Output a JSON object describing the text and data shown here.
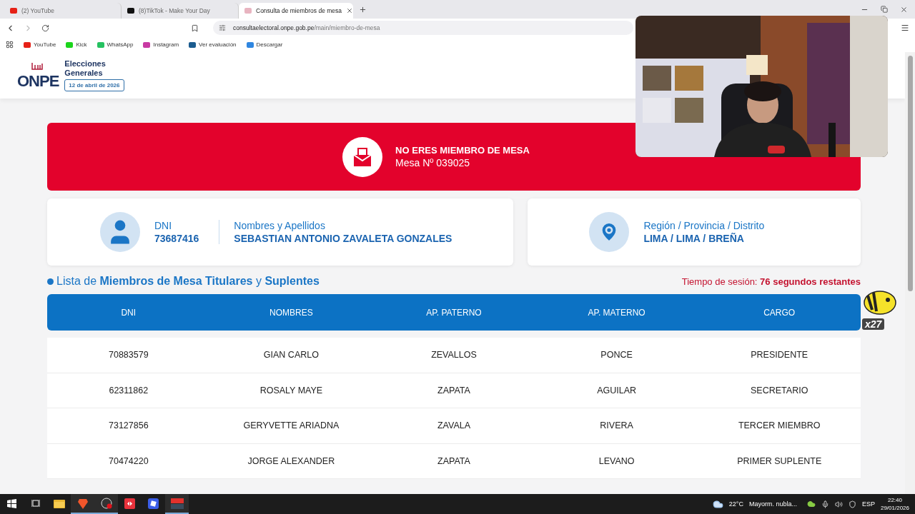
{
  "browser": {
    "tabs": [
      {
        "title": "(2) YouTube",
        "kind": "video",
        "selected": false
      },
      {
        "title": "(8)TikTok - Make Your Day",
        "kind": "note",
        "selected": false
      },
      {
        "title": "Consulta de miembros de mesa",
        "kind": "onpe",
        "selected": true
      }
    ],
    "address": {
      "host": "consultaelectoral.onpe.gob.pe",
      "path": "/main/miembro-de-mesa"
    },
    "bookmarks": [
      {
        "label": "YouTube",
        "color": "#e62117"
      },
      {
        "label": "Kick",
        "color": "#1bd51b"
      },
      {
        "label": "WhatsApp",
        "color": "#25c160"
      },
      {
        "label": "Instagram",
        "color": "#c83aa3"
      },
      {
        "label": "Ver evaluación",
        "color": "#1b5c8f"
      },
      {
        "label": "Descargar",
        "color": "#2f86e0"
      }
    ]
  },
  "header": {
    "logo": "ONPE",
    "event_line_1": "Elecciones",
    "event_line_2": "Generales",
    "date": "12 de abril de 2026"
  },
  "result": {
    "title": "NO ERES MIEMBRO DE MESA",
    "mesa": "Mesa Nº 039025"
  },
  "person": {
    "dni_label": "DNI",
    "dni": "73687416",
    "name_label": "Nombres y Apellidos",
    "name": "SEBASTIAN ANTONIO ZAVALETA GONZALES"
  },
  "location": {
    "label": "Región / Provincia / Distrito",
    "value": "LIMA / LIMA / BREÑA"
  },
  "list_title": "Lista de **Miembros de Mesa Titulares** y **Suplentes**",
  "session": {
    "label": "Tiempo de sesión:",
    "value": "76 segundos restantes"
  },
  "table": {
    "columns": [
      "DNI",
      "NOMBRES",
      "AP. PATERNO",
      "AP. MATERNO",
      "CARGO"
    ],
    "rows": [
      [
        "70883579",
        "GIAN CARLO",
        "ZEVALLOS",
        "PONCE",
        "PRESIDENTE"
      ],
      [
        "62311862",
        "ROSALY MAYE",
        "ZAPATA",
        "AGUILAR",
        "SECRETARIO"
      ],
      [
        "73127856",
        "GERYVETTE ARIADNA",
        "ZAVALA",
        "RIVERA",
        "TERCER MIEMBRO"
      ],
      [
        "70474220",
        "JORGE ALEXANDER",
        "ZAPATA",
        "LEVANO",
        "PRIMER SUPLENTE"
      ]
    ]
  },
  "overlay": {
    "sticker": "x27"
  },
  "taskbar": {
    "apps": [
      {
        "kind": "folder",
        "running": false
      },
      {
        "kind": "lion",
        "running": true
      },
      {
        "kind": "record",
        "running": true
      },
      {
        "kind": "remote",
        "running": false
      },
      {
        "kind": "cube",
        "running": false
      },
      {
        "kind": "mixer",
        "running": true
      }
    ],
    "weather": {
      "temp": "22°C",
      "text": "Mayorm. nubla..."
    },
    "lang": "ESP",
    "time": "22:40",
    "date": "29/01/2026"
  }
}
